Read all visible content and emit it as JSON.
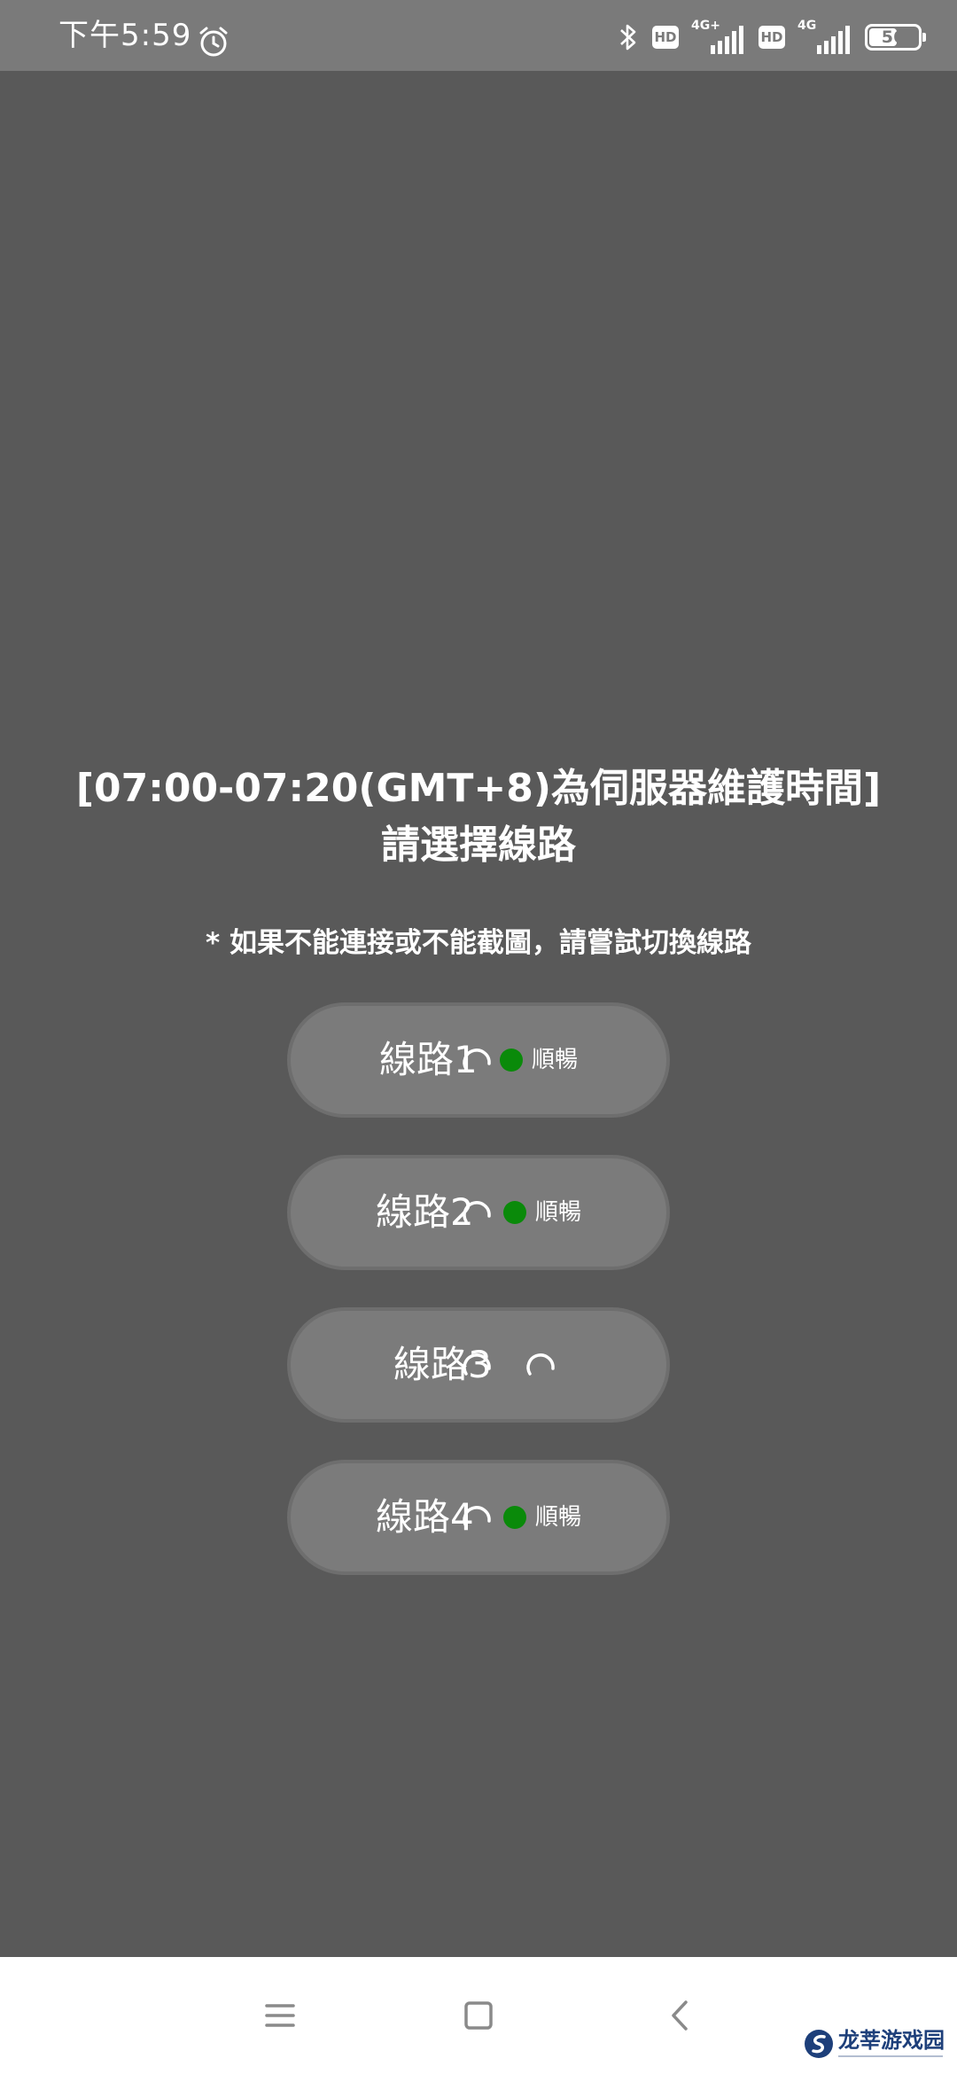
{
  "status_bar": {
    "time": "下午5:59",
    "alarm_icon": "alarm-clock-icon",
    "bluetooth_icon": "bluetooth-icon",
    "sim1": {
      "hd": "HD",
      "network": "4G+"
    },
    "sim2": {
      "hd": "HD",
      "network": "4G"
    },
    "battery_level": "56"
  },
  "main": {
    "maintenance_notice": "[07:00-07:20(GMT+8)為伺服器維護時間]",
    "title": "請選擇線路",
    "hint": "* 如果不能連接或不能截圖，請嘗試切換線路",
    "lines": [
      {
        "label": "線路1",
        "status": "順暢",
        "status_color": "#0a8a0a",
        "loading": true
      },
      {
        "label": "線路2",
        "status": "順暢",
        "status_color": "#0a8a0a",
        "loading": true
      },
      {
        "label": "線路3",
        "status": "",
        "status_color": "",
        "loading": true
      },
      {
        "label": "線路4",
        "status": "順暢",
        "status_color": "#0a8a0a",
        "loading": true
      }
    ]
  },
  "nav_bar": {
    "menu_icon": "menu-icon",
    "home_icon": "home-square-icon",
    "back_icon": "back-chevron-icon"
  },
  "watermark": {
    "text": "龙莘游戏园"
  },
  "colors": {
    "background": "#595959",
    "status_bar": "#7a7a7a",
    "button": "#7b7b7b",
    "ok_green": "#0a8a0a"
  }
}
